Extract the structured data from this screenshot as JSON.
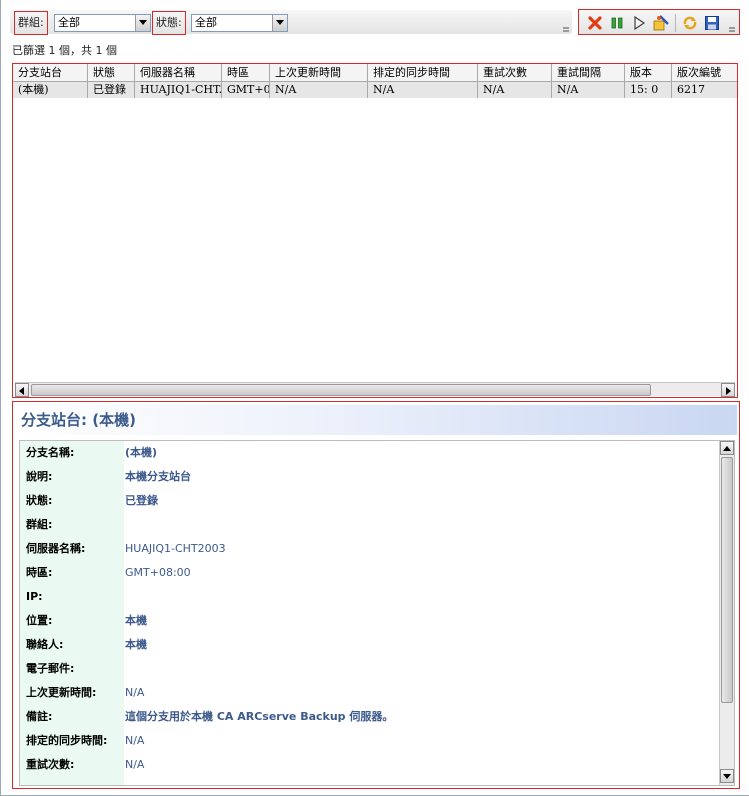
{
  "filters": {
    "group_label": "群組:",
    "group_value": "全部",
    "status_label": "狀態:",
    "status_value": "全部"
  },
  "toolbar_icons": [
    "delete-icon",
    "pause-icon",
    "play-icon",
    "wizard-icon",
    "refresh-icon",
    "save-icon"
  ],
  "status_line": "已篩選 1 個，共 1 個",
  "grid": {
    "columns": [
      "分支站台",
      "狀態",
      "伺服器名稱",
      "時區",
      "上次更新時間",
      "排定的同步時間",
      "重試次數",
      "重試間隔",
      "版本",
      "版次編號"
    ],
    "rows": [
      [
        "(本機)",
        "已登錄",
        "HUAJIQ1-CHT.",
        "GMT+0",
        "N/A",
        "N/A",
        "N/A",
        "N/A",
        "15: 0",
        "6217"
      ]
    ]
  },
  "details": {
    "title": "分支站台: (本機)",
    "rows": [
      {
        "label": "分支名稱:",
        "value": "(本機)",
        "bold": true
      },
      {
        "label": "說明:",
        "value": "本機分支站台",
        "bold": true
      },
      {
        "label": "狀態:",
        "value": "已登錄",
        "bold": true
      },
      {
        "label": "群組:",
        "value": "",
        "bold": false
      },
      {
        "label": "伺服器名稱:",
        "value": "HUAJIQ1-CHT2003",
        "bold": false
      },
      {
        "label": "時區:",
        "value": "GMT+08:00",
        "bold": false
      },
      {
        "label": "IP:",
        "value": "",
        "bold": false
      },
      {
        "label": "位置:",
        "value": "本機",
        "bold": true
      },
      {
        "label": "聯絡人:",
        "value": "本機",
        "bold": true
      },
      {
        "label": "電子郵件:",
        "value": "",
        "bold": false
      },
      {
        "label": "上次更新時間:",
        "value": "N/A",
        "bold": false
      },
      {
        "label": "備註:",
        "value": "這個分支用於本機 CA ARCserve Backup 伺服器。",
        "bold": true
      },
      {
        "label": "排定的同步時間:",
        "value": "N/A",
        "bold": false
      },
      {
        "label": "重試次數:",
        "value": "N/A",
        "bold": false
      }
    ]
  },
  "colors": {
    "highlight_border": "#d32a2a",
    "title_text": "#3c5a8c",
    "value_text": "#3c5a8c",
    "label_bg": "#eafaf2",
    "row_selected_bg": "#e6e6e6"
  }
}
